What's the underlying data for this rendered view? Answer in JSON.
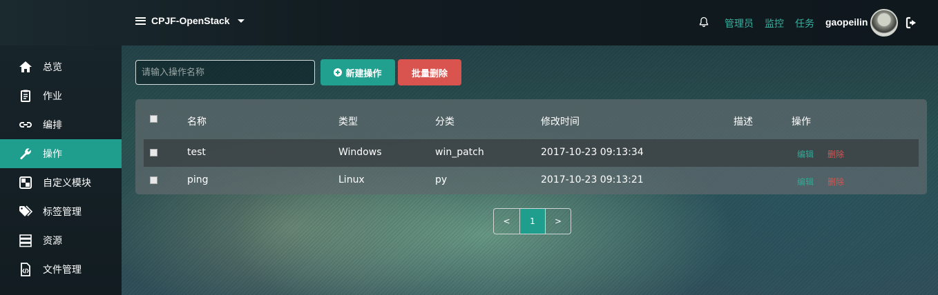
{
  "topbar": {
    "project_name": "CPJF-OpenStack",
    "links": [
      "管理员",
      "监控",
      "任务"
    ],
    "username": "gaopeilin"
  },
  "sidebar": {
    "items": [
      {
        "label": "总览",
        "icon": "home-icon"
      },
      {
        "label": "作业",
        "icon": "clipboard-icon"
      },
      {
        "label": "编排",
        "icon": "link-icon"
      },
      {
        "label": "操作",
        "icon": "wrench-icon",
        "active": true
      },
      {
        "label": "自定义模块",
        "icon": "module-icon"
      },
      {
        "label": "标签管理",
        "icon": "tags-icon"
      },
      {
        "label": "资源",
        "icon": "server-icon"
      },
      {
        "label": "文件管理",
        "icon": "code-file-icon"
      }
    ]
  },
  "toolbar": {
    "search_placeholder": "请输入操作名称",
    "new_label": "新建操作",
    "batch_delete_label": "批量删除"
  },
  "table": {
    "headers": [
      "名称",
      "类型",
      "分类",
      "修改时间",
      "描述",
      "操作"
    ],
    "rows": [
      {
        "name": "test",
        "type": "Windows",
        "category": "win_patch",
        "modified": "2017-10-23 09:13:34",
        "description": "",
        "edit": "编辑",
        "delete": "删除"
      },
      {
        "name": "ping",
        "type": "Linux",
        "category": "py",
        "modified": "2017-10-23 09:13:21",
        "description": "",
        "edit": "编辑",
        "delete": "删除"
      }
    ]
  },
  "pagination": {
    "prev": "<",
    "current": "1",
    "next": ">"
  },
  "colors": {
    "accent": "#1f9e8e",
    "danger": "#d9534f",
    "link": "#35b3a0"
  }
}
